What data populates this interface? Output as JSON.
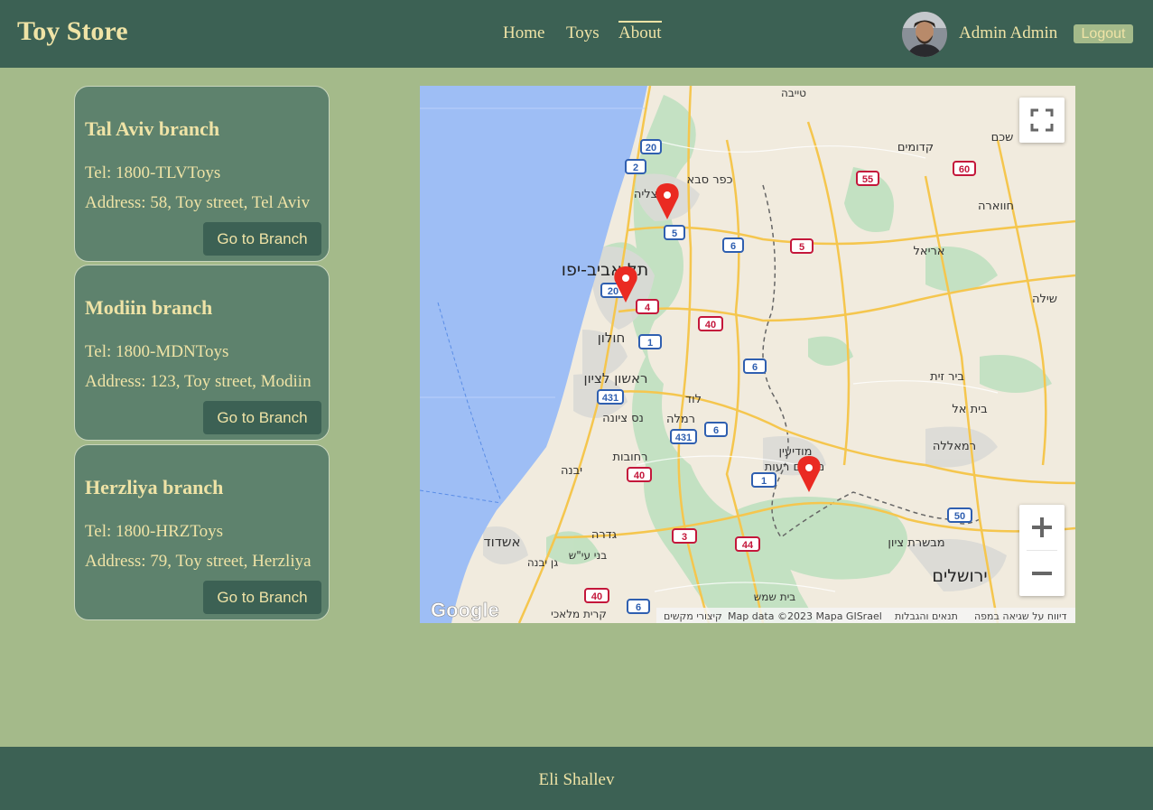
{
  "navbar": {
    "brand": "Toy Store",
    "links": [
      "Home",
      "Toys",
      "About"
    ],
    "active_link": "About",
    "user_name": "Admin Admin",
    "logout_label": "Logout"
  },
  "branches": [
    {
      "title": "Tal Aviv branch",
      "tel": "Tel: 1800-TLVToys",
      "address": "Address: 58, Toy street, Tel Aviv",
      "button": "Go to Branch"
    },
    {
      "title": "Modiin branch",
      "tel": "Tel: 1800-MDNToys",
      "address": "Address: 123, Toy street, Modiin",
      "button": "Go to Branch"
    },
    {
      "title": "Herzliya branch",
      "tel": "Tel: 1800-HRZToys",
      "address": "Address: 79, Toy street, Herzliya",
      "button": "Go to Branch"
    }
  ],
  "map": {
    "logo": "Google",
    "attribution": [
      "קיצורי מקשים",
      "Map data ©2023 Mapa GISrael",
      "תנאים והגבלות",
      "דיווח על שגיאה במפה"
    ],
    "city_labels": [
      "טייבה",
      "כפר סבא",
      "הרצליה",
      "תל אביב-יפו",
      "חולון",
      "ראשון לציון",
      "נס ציונה",
      "רמלה",
      "לוד",
      "רחובות",
      "יבנה",
      "גדרה",
      "אשדוד",
      "גן יבנה",
      "בני עי\"ש",
      "קרית מלאכי",
      "בית שמש",
      "מודיעין",
      "מכבים רעות",
      "קדומים",
      "שכם",
      "חווארה",
      "אריאל",
      "שילה",
      "ביר זית",
      "בית אל",
      "רמאללה",
      "מבשרת ציון",
      "ירושלים"
    ],
    "road_shields": [
      "20",
      "2",
      "5",
      "6",
      "55",
      "60",
      "5",
      "4",
      "40",
      "1",
      "6",
      "431",
      "431",
      "6",
      "40",
      "1",
      "3",
      "44",
      "40",
      "6",
      "50",
      "20"
    ],
    "marker_count": 3
  },
  "footer": {
    "text": "Eli Shallev"
  }
}
